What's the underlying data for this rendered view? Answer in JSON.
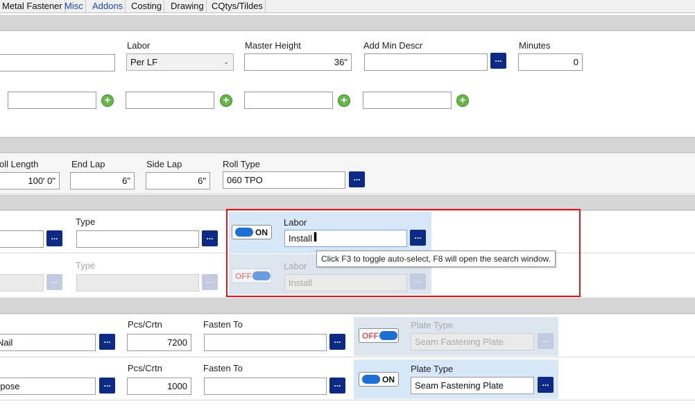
{
  "tabs": [
    "Metal Fastener",
    "Misc",
    "Addons",
    "Costing",
    "Drawing",
    "CQtys/Tildes"
  ],
  "section1": {
    "labor_label": "Labor",
    "labor_value": "Per LF",
    "master_height_label": "Master Height",
    "master_height_value": "36\"",
    "add_min_descr_label": "Add Min Descr",
    "add_min_descr_value": "",
    "minutes_label": "Minutes",
    "minutes_value": "0"
  },
  "section2": {
    "roll_length_label": "oll Length",
    "roll_length_value": "100' 0\"",
    "end_lap_label": "End Lap",
    "end_lap_value": "6\"",
    "side_lap_label": "Side Lap",
    "side_lap_value": "6\"",
    "roll_type_label": "Roll Type",
    "roll_type_value": "060 TPO"
  },
  "section3": {
    "type_label": "Type",
    "toggle_on": "ON",
    "toggle_off": "OFF",
    "labor_label": "Labor",
    "labor_value": "Install",
    "labor_value_dim": "Install",
    "tooltip": "Click F3 to toggle auto-select, F8 will open the search window."
  },
  "section4": {
    "row1": {
      "name_value": "Nail",
      "pcs_label": "Pcs/Crtn",
      "pcs_value": "7200",
      "fasten_label": "Fasten To",
      "fasten_value": "",
      "toggle": "OFF",
      "plate_type_label": "Plate Type",
      "plate_type_value": "Seam Fastening Plate"
    },
    "row2": {
      "name_value": "rpose",
      "pcs_label": "Pcs/Crtn",
      "pcs_value": "1000",
      "fasten_label": "Fasten To",
      "fasten_value": "",
      "toggle": "ON",
      "plate_type_label": "Plate Type",
      "plate_type_value": "Seam Fastening Plate"
    }
  },
  "icons": {
    "dots": "...",
    "plus": "+",
    "dropdown_arrow": "⌄",
    "text_cursor": "I"
  },
  "colors": {
    "browse_button": "#0d2b86",
    "add_button": "#66b64a",
    "highlight_box": "#e2141c",
    "toggle_knob": "#1f6ed4",
    "panel_blue": "#d6e7f8"
  }
}
